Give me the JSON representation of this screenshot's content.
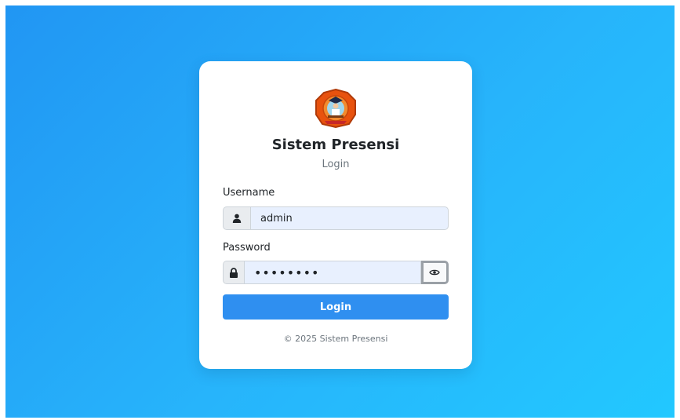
{
  "app": {
    "title": "Sistem Presensi",
    "subtitle": "Login"
  },
  "form": {
    "username_label": "Username",
    "username_value": "admin",
    "password_label": "Password",
    "password_value": "password",
    "submit_label": "Login"
  },
  "icons": {
    "username": "user-icon",
    "password": "lock-icon",
    "toggle": "eye-icon",
    "logo": "school-emblem-logo"
  },
  "colors": {
    "background_start": "#2196f3",
    "background_end": "#22c8ff",
    "button": "#2f8ff0",
    "input_fill": "#e8f0fe"
  },
  "footer": {
    "text": "© 2025 Sistem Presensi"
  }
}
